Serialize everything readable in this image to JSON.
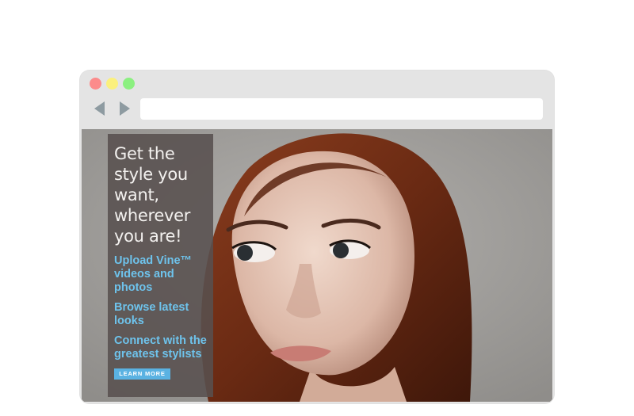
{
  "browser": {
    "controls": {
      "close_color": "#fc8b8b",
      "minimize_color": "#fbf07d",
      "maximize_color": "#8bf080"
    },
    "nav": {
      "back_icon": "triangle-left-icon",
      "forward_icon": "triangle-right-icon"
    },
    "address_bar": {
      "value": "",
      "placeholder": ""
    }
  },
  "hero": {
    "image": "portrait-photo",
    "headline": "Get the style you want, wherever you are!",
    "features": [
      "Upload Vine™ videos and photos",
      "Browse latest looks",
      "Connect with the greatest stylists"
    ],
    "cta_label": "LEARN MORE",
    "colors": {
      "panel_bg": "#58504e",
      "link": "#6ec3ec",
      "button": "#5ab2e2"
    }
  }
}
